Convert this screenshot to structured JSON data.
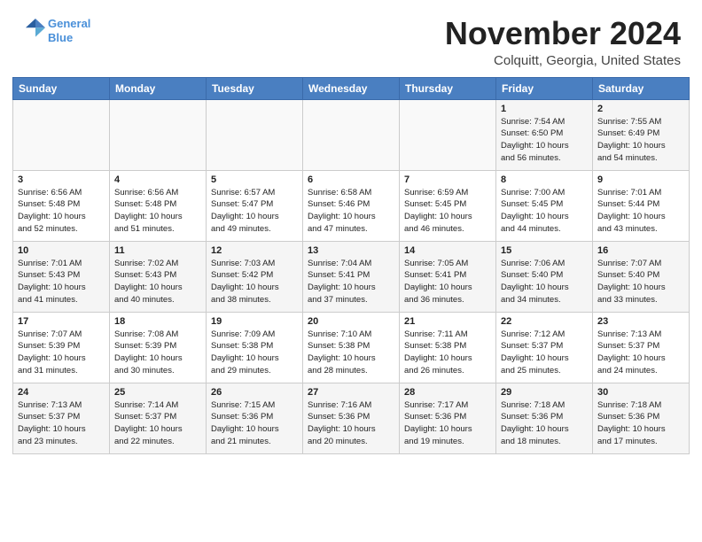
{
  "header": {
    "logo_line1": "General",
    "logo_line2": "Blue",
    "month": "November 2024",
    "location": "Colquitt, Georgia, United States"
  },
  "weekdays": [
    "Sunday",
    "Monday",
    "Tuesday",
    "Wednesday",
    "Thursday",
    "Friday",
    "Saturday"
  ],
  "weeks": [
    [
      {
        "day": "",
        "info": ""
      },
      {
        "day": "",
        "info": ""
      },
      {
        "day": "",
        "info": ""
      },
      {
        "day": "",
        "info": ""
      },
      {
        "day": "",
        "info": ""
      },
      {
        "day": "1",
        "info": "Sunrise: 7:54 AM\nSunset: 6:50 PM\nDaylight: 10 hours\nand 56 minutes."
      },
      {
        "day": "2",
        "info": "Sunrise: 7:55 AM\nSunset: 6:49 PM\nDaylight: 10 hours\nand 54 minutes."
      }
    ],
    [
      {
        "day": "3",
        "info": "Sunrise: 6:56 AM\nSunset: 5:48 PM\nDaylight: 10 hours\nand 52 minutes."
      },
      {
        "day": "4",
        "info": "Sunrise: 6:56 AM\nSunset: 5:48 PM\nDaylight: 10 hours\nand 51 minutes."
      },
      {
        "day": "5",
        "info": "Sunrise: 6:57 AM\nSunset: 5:47 PM\nDaylight: 10 hours\nand 49 minutes."
      },
      {
        "day": "6",
        "info": "Sunrise: 6:58 AM\nSunset: 5:46 PM\nDaylight: 10 hours\nand 47 minutes."
      },
      {
        "day": "7",
        "info": "Sunrise: 6:59 AM\nSunset: 5:45 PM\nDaylight: 10 hours\nand 46 minutes."
      },
      {
        "day": "8",
        "info": "Sunrise: 7:00 AM\nSunset: 5:45 PM\nDaylight: 10 hours\nand 44 minutes."
      },
      {
        "day": "9",
        "info": "Sunrise: 7:01 AM\nSunset: 5:44 PM\nDaylight: 10 hours\nand 43 minutes."
      }
    ],
    [
      {
        "day": "10",
        "info": "Sunrise: 7:01 AM\nSunset: 5:43 PM\nDaylight: 10 hours\nand 41 minutes."
      },
      {
        "day": "11",
        "info": "Sunrise: 7:02 AM\nSunset: 5:43 PM\nDaylight: 10 hours\nand 40 minutes."
      },
      {
        "day": "12",
        "info": "Sunrise: 7:03 AM\nSunset: 5:42 PM\nDaylight: 10 hours\nand 38 minutes."
      },
      {
        "day": "13",
        "info": "Sunrise: 7:04 AM\nSunset: 5:41 PM\nDaylight: 10 hours\nand 37 minutes."
      },
      {
        "day": "14",
        "info": "Sunrise: 7:05 AM\nSunset: 5:41 PM\nDaylight: 10 hours\nand 36 minutes."
      },
      {
        "day": "15",
        "info": "Sunrise: 7:06 AM\nSunset: 5:40 PM\nDaylight: 10 hours\nand 34 minutes."
      },
      {
        "day": "16",
        "info": "Sunrise: 7:07 AM\nSunset: 5:40 PM\nDaylight: 10 hours\nand 33 minutes."
      }
    ],
    [
      {
        "day": "17",
        "info": "Sunrise: 7:07 AM\nSunset: 5:39 PM\nDaylight: 10 hours\nand 31 minutes."
      },
      {
        "day": "18",
        "info": "Sunrise: 7:08 AM\nSunset: 5:39 PM\nDaylight: 10 hours\nand 30 minutes."
      },
      {
        "day": "19",
        "info": "Sunrise: 7:09 AM\nSunset: 5:38 PM\nDaylight: 10 hours\nand 29 minutes."
      },
      {
        "day": "20",
        "info": "Sunrise: 7:10 AM\nSunset: 5:38 PM\nDaylight: 10 hours\nand 28 minutes."
      },
      {
        "day": "21",
        "info": "Sunrise: 7:11 AM\nSunset: 5:38 PM\nDaylight: 10 hours\nand 26 minutes."
      },
      {
        "day": "22",
        "info": "Sunrise: 7:12 AM\nSunset: 5:37 PM\nDaylight: 10 hours\nand 25 minutes."
      },
      {
        "day": "23",
        "info": "Sunrise: 7:13 AM\nSunset: 5:37 PM\nDaylight: 10 hours\nand 24 minutes."
      }
    ],
    [
      {
        "day": "24",
        "info": "Sunrise: 7:13 AM\nSunset: 5:37 PM\nDaylight: 10 hours\nand 23 minutes."
      },
      {
        "day": "25",
        "info": "Sunrise: 7:14 AM\nSunset: 5:37 PM\nDaylight: 10 hours\nand 22 minutes."
      },
      {
        "day": "26",
        "info": "Sunrise: 7:15 AM\nSunset: 5:36 PM\nDaylight: 10 hours\nand 21 minutes."
      },
      {
        "day": "27",
        "info": "Sunrise: 7:16 AM\nSunset: 5:36 PM\nDaylight: 10 hours\nand 20 minutes."
      },
      {
        "day": "28",
        "info": "Sunrise: 7:17 AM\nSunset: 5:36 PM\nDaylight: 10 hours\nand 19 minutes."
      },
      {
        "day": "29",
        "info": "Sunrise: 7:18 AM\nSunset: 5:36 PM\nDaylight: 10 hours\nand 18 minutes."
      },
      {
        "day": "30",
        "info": "Sunrise: 7:18 AM\nSunset: 5:36 PM\nDaylight: 10 hours\nand 17 minutes."
      }
    ]
  ]
}
